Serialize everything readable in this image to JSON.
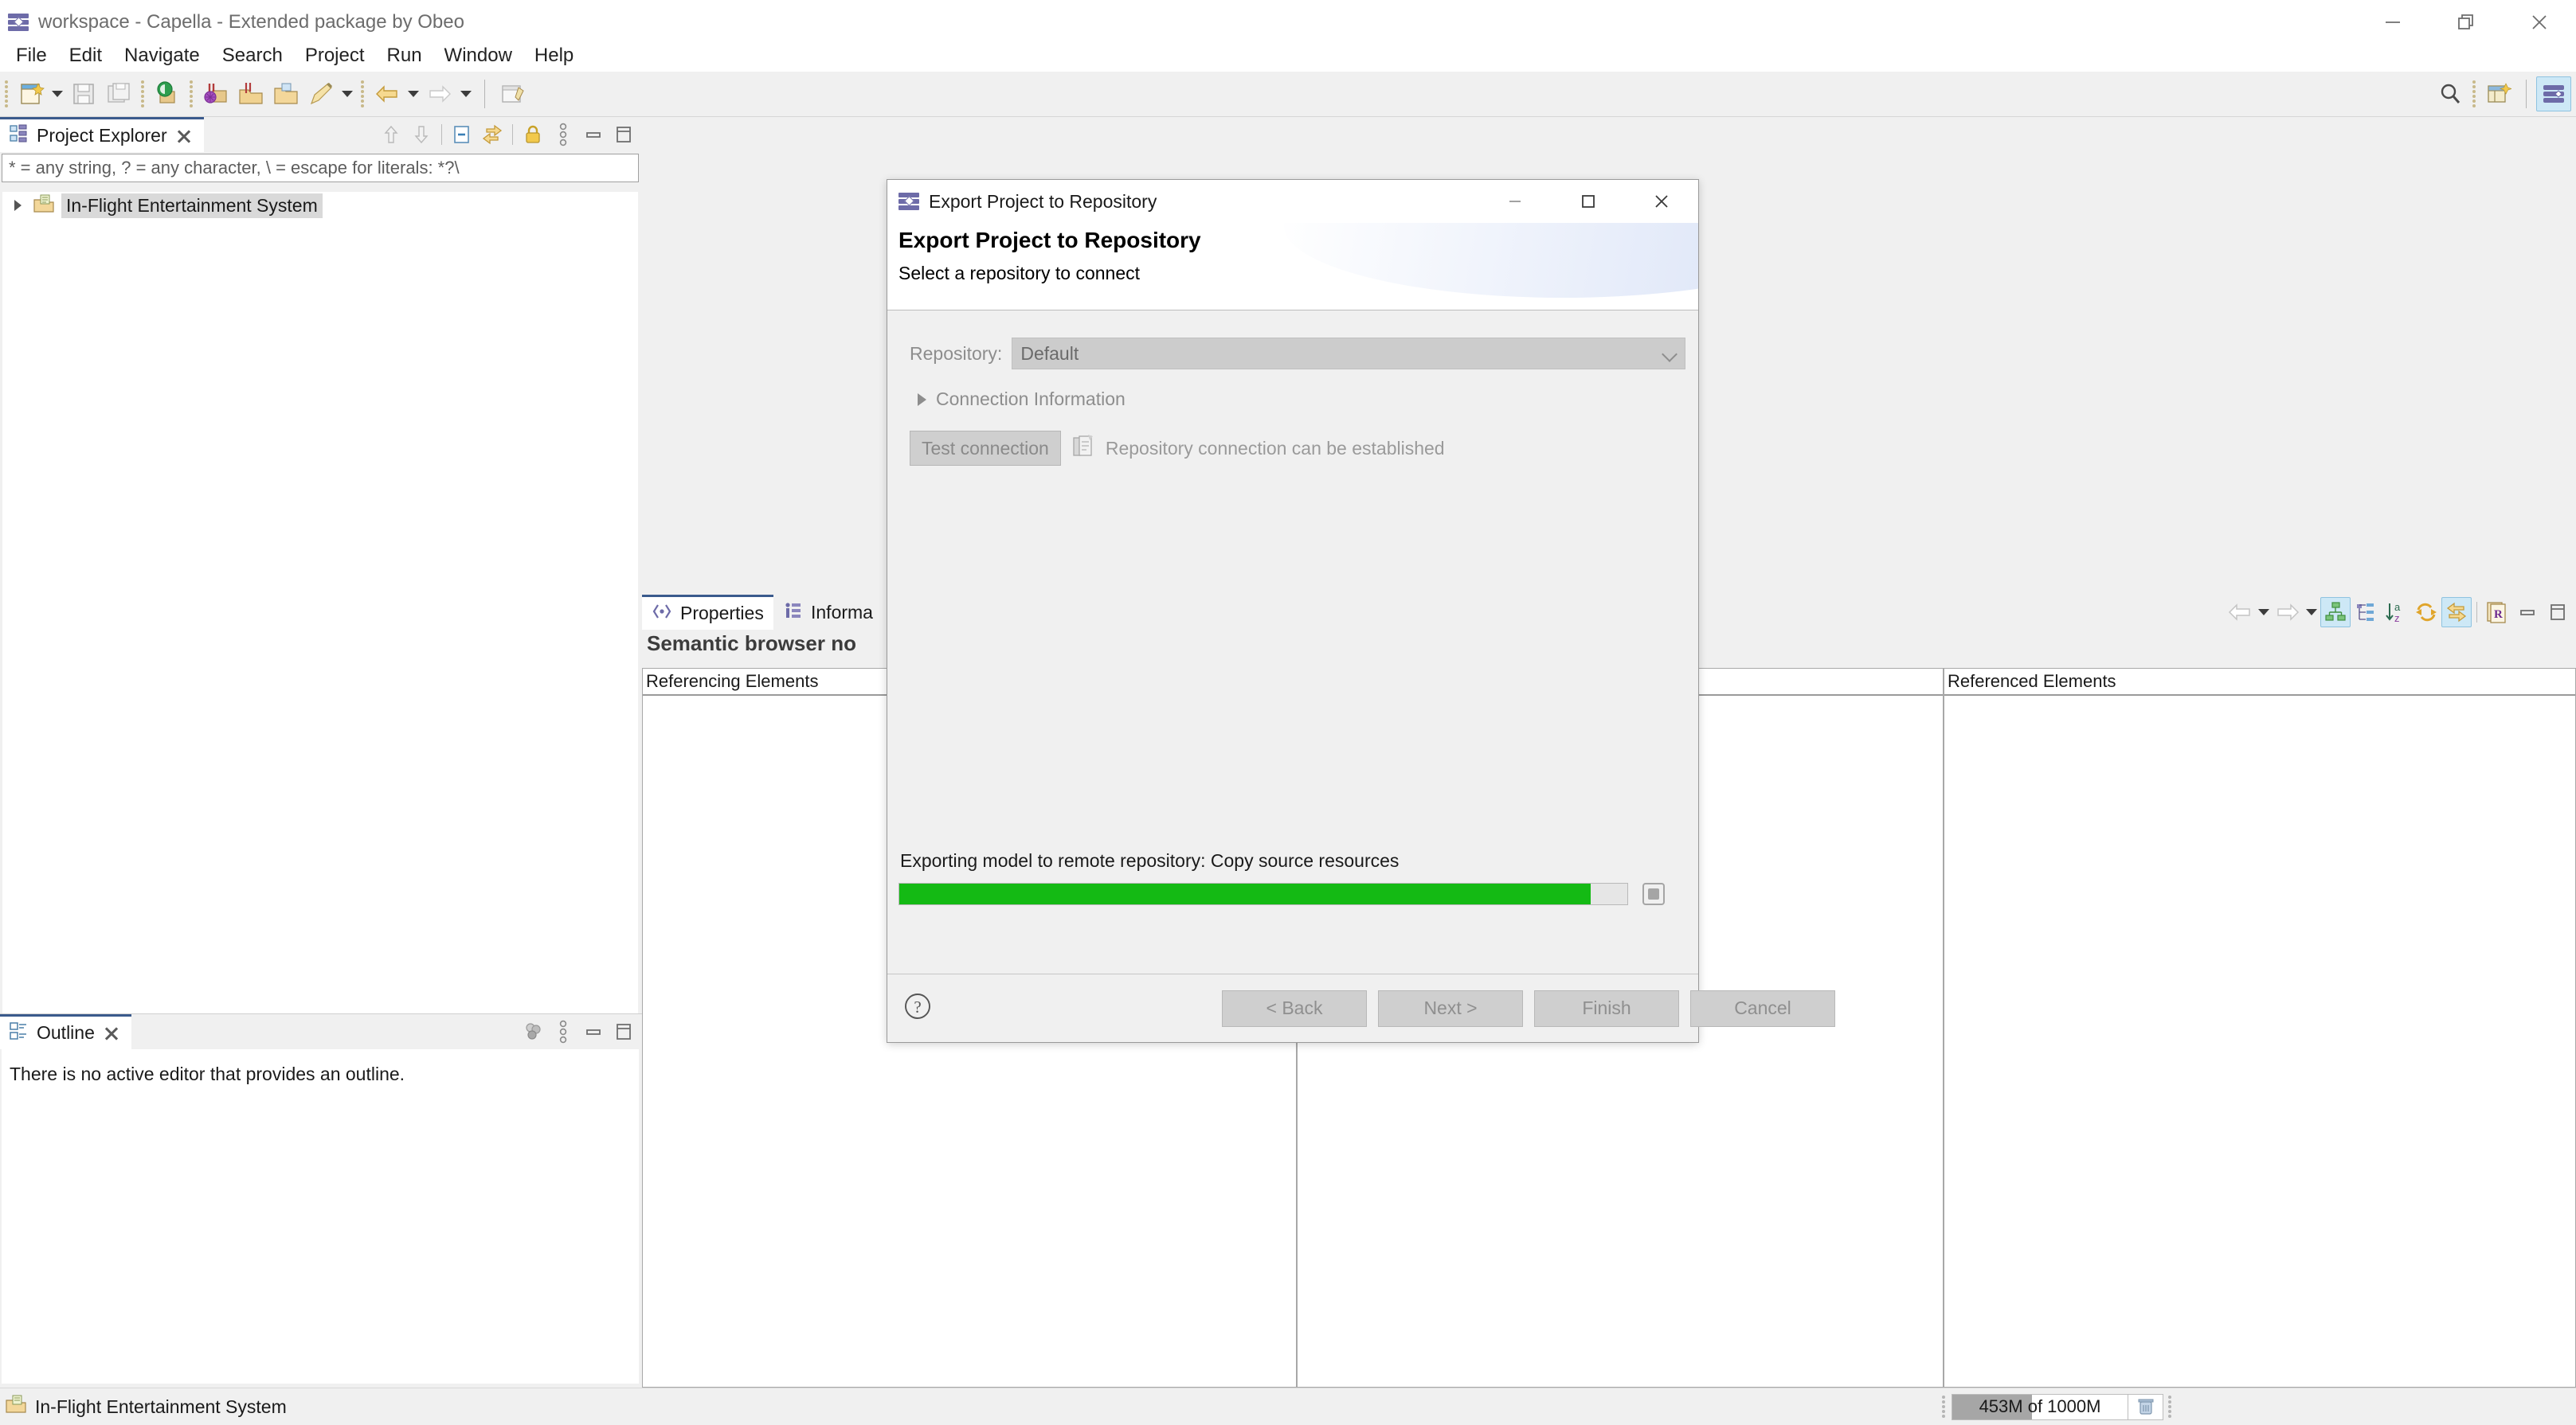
{
  "window": {
    "title": "workspace - Capella - Extended package by Obeo",
    "controls": {
      "minimize": "minimize-icon",
      "restore": "restore-icon",
      "close": "close-icon"
    }
  },
  "menubar": {
    "items": [
      {
        "label": "File"
      },
      {
        "label": "Edit"
      },
      {
        "label": "Navigate"
      },
      {
        "label": "Search"
      },
      {
        "label": "Project"
      },
      {
        "label": "Run"
      },
      {
        "label": "Window"
      },
      {
        "label": "Help"
      }
    ]
  },
  "toolbar": {
    "icons": [
      "new-wizard-icon",
      "new-dropdown-arrow",
      "save-icon",
      "save-all-icon",
      "capella-project-icon",
      "validate-model-icon",
      "open-model-icon",
      "open-folder-icon",
      "pencil-icon",
      "pencil-dropdown-arrow",
      "back-arrow-icon",
      "back-dropdown-arrow",
      "forward-arrow-icon",
      "forward-dropdown-arrow",
      "new-editor-icon"
    ],
    "right_icons": [
      "search-icon",
      "new-perspective-icon",
      "capella-perspective-icon"
    ]
  },
  "project_explorer": {
    "tab_label": "Project Explorer",
    "filter_placeholder": "* = any string, ? = any character, \\ = escape for literals: *?\\",
    "tools": [
      "collapse-up-icon",
      "expand-down-icon",
      "collapse-all-icon",
      "link-with-editor-icon",
      "lock-icon",
      "view-menu-icon",
      "minimize-icon",
      "maximize-icon"
    ],
    "tree": [
      {
        "label": "In-Flight Entertainment System",
        "icon": "capella-project-icon",
        "expanded": false,
        "selected": true
      }
    ]
  },
  "outline": {
    "tab_label": "Outline",
    "empty_message": "There is no active editor that provides an outline.",
    "tools": [
      "filters-icon",
      "view-menu-icon",
      "minimize-icon",
      "maximize-icon"
    ]
  },
  "bottom_panel": {
    "tabs": [
      {
        "label": "Properties",
        "icon": "properties-icon",
        "active": true
      },
      {
        "label": "Informa",
        "icon": "information-icon",
        "active": false
      }
    ],
    "heading": "Semantic browser no",
    "columns": [
      {
        "header": "Referencing Elements"
      },
      {
        "header": ""
      },
      {
        "header": "Referenced Elements"
      }
    ],
    "tools": [
      "back-arrow-icon",
      "back-dropdown-arrow",
      "forward-arrow-icon",
      "forward-dropdown-arrow",
      "show-diagram-icon",
      "tree-layout-icon",
      "sort-az-icon",
      "refresh-icon",
      "link-with-editor-icon",
      "requirements-icon",
      "minimize-icon",
      "maximize-icon"
    ]
  },
  "statusbar": {
    "selection_label": "In-Flight Entertainment System",
    "selection_icon": "capella-project-icon",
    "heap": {
      "text": "453M of 1000M",
      "used_percent": 45.3,
      "trash_icon": "trash-icon"
    }
  },
  "dialog": {
    "titlebar": {
      "title": "Export Project to Repository",
      "icon": "capella-logo-icon"
    },
    "banner": {
      "heading": "Export Project to Repository",
      "subheading": "Select a repository to connect"
    },
    "repository": {
      "label": "Repository:",
      "value": "Default",
      "options": [
        "Default"
      ],
      "disabled": true
    },
    "connection_information": {
      "label": "Connection Information",
      "expanded": false
    },
    "test_connection": {
      "button_label": "Test connection",
      "status_icon": "connection-status-icon",
      "status_message": "Repository connection can be established"
    },
    "progress": {
      "label": "Exporting model to remote repository: Copy source resources",
      "percent": 95,
      "stop_icon": "stop-icon"
    },
    "footer": {
      "help_icon": "help-icon",
      "buttons": [
        {
          "label": "< Back",
          "enabled": false
        },
        {
          "label": "Next >",
          "enabled": false
        },
        {
          "label": "Finish",
          "enabled": false
        },
        {
          "label": "Cancel",
          "enabled": false
        }
      ]
    }
  },
  "colors": {
    "accent": "#3a5a8c",
    "progress_green": "#14ba14",
    "selection_gray": "#d9d9d9",
    "window_bg": "#f0f0f0"
  }
}
